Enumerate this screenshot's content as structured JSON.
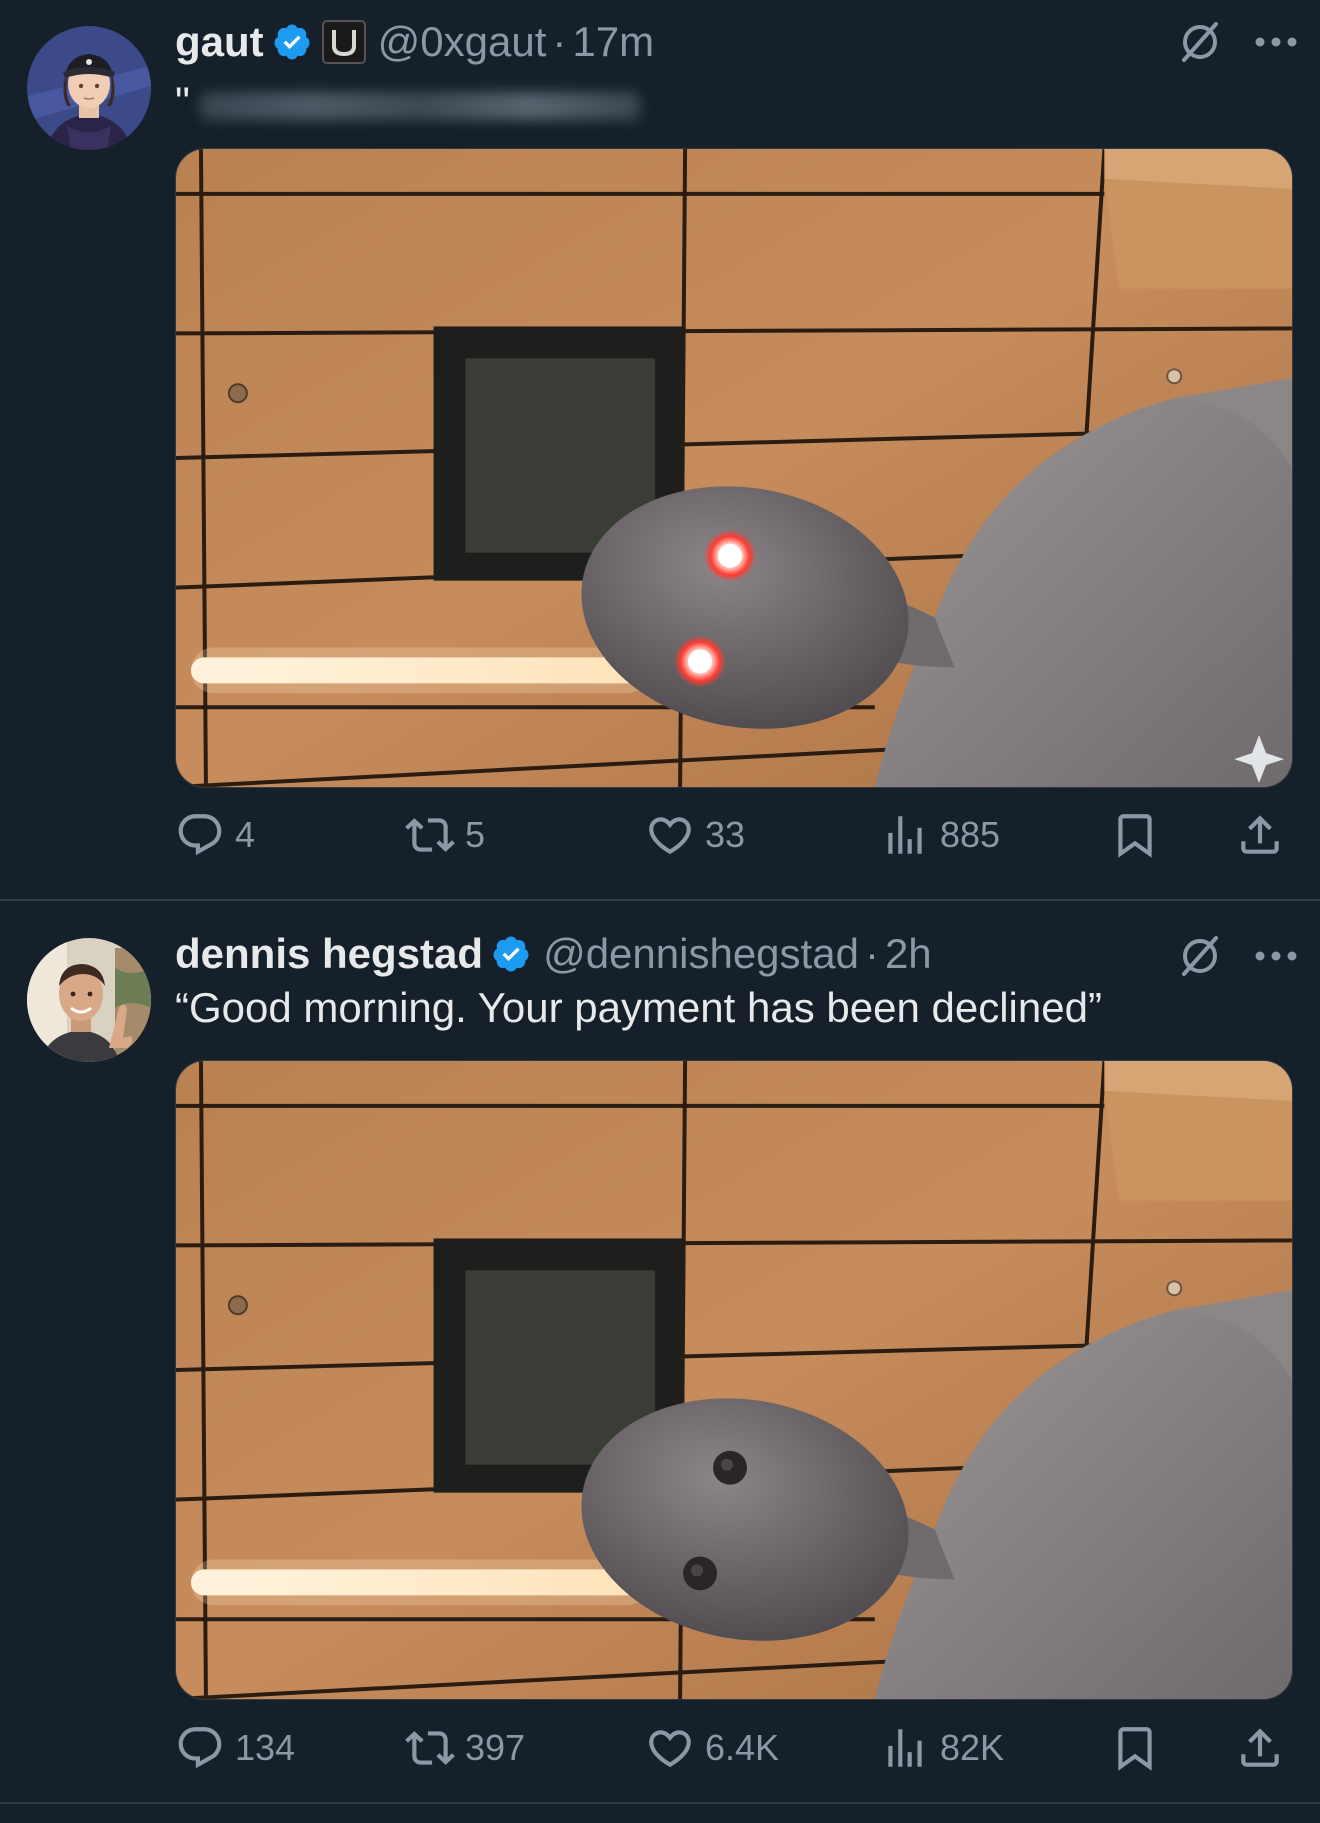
{
  "tweets": [
    {
      "author": {
        "name": "gaut",
        "handle": "@0xgaut",
        "time": "17m",
        "avatar_icon": "avatar-cartoon-icon",
        "verified": true,
        "affiliation_icon": "affiliation-badge-icon"
      },
      "text": "\"",
      "media": {
        "eyes": "glowing-red"
      },
      "metrics": {
        "replies": "4",
        "retweets": "5",
        "likes": "33",
        "views": "885"
      }
    },
    {
      "author": {
        "name": "dennis hegstad",
        "handle": "@dennishegstad",
        "time": "2h",
        "avatar_icon": "avatar-photo-icon",
        "verified": true
      },
      "text": "“Good morning. Your payment has been declined”",
      "media": {
        "eyes": "dark"
      },
      "metrics": {
        "replies": "134",
        "retweets": "397",
        "likes": "6.4K",
        "views": "82K"
      }
    }
  ],
  "separator": "·",
  "colors": {
    "background": "#15202b",
    "text": "#e7e9ea",
    "muted": "#8b98a5",
    "verified": "#1d9bf0",
    "divider": "#2f3b47"
  }
}
